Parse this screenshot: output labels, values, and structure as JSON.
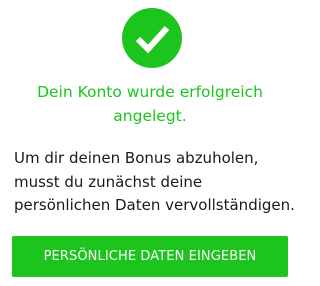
{
  "success": {
    "icon": "check-icon",
    "title": "Dein Konto wurde erfolgreich\nangelegt."
  },
  "info": {
    "text": "Um dir deinen Bonus abzuholen,\nmusst du zunächst deine\npersönlichen Daten vervollständigen."
  },
  "cta": {
    "label": "PERSÖNLICHE DATEN EINGEBEN"
  },
  "colors": {
    "accent": "#1ec41e",
    "text": "#1a1a1a",
    "background": "#ffffff"
  }
}
